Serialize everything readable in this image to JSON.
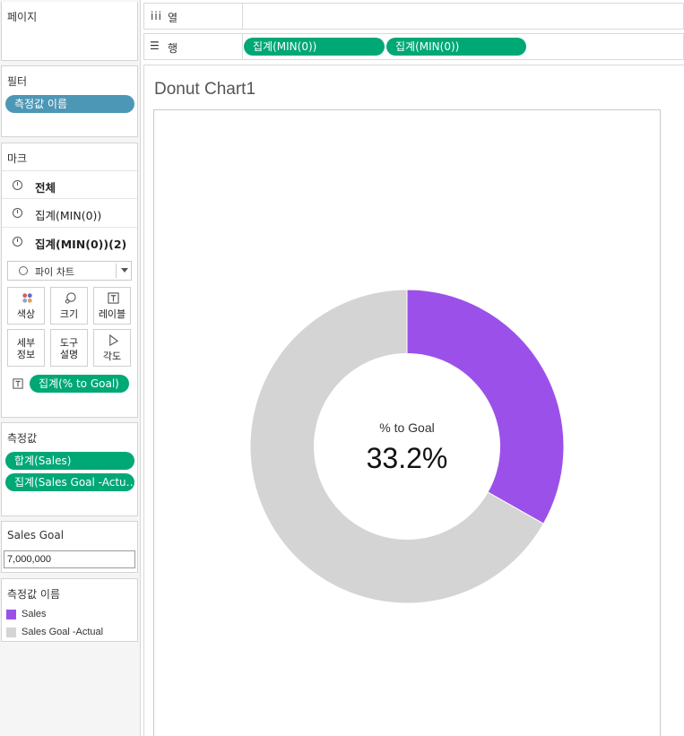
{
  "shelves": {
    "pages_label": "페이지",
    "columns_label": "열",
    "rows_label": "행",
    "row_pills": [
      "집계(MIN(0))",
      "집계(MIN(0))"
    ]
  },
  "filters": {
    "title": "필터",
    "pills": [
      "측정값 이름"
    ]
  },
  "marks": {
    "title": "마크",
    "items": [
      {
        "label": "전체",
        "bold": false
      },
      {
        "label": "집계(MIN(0))",
        "bold": false
      },
      {
        "label": "집계(MIN(0))(2)",
        "bold": true
      }
    ],
    "mark_type": "파이 차트",
    "buttons": [
      "색상",
      "크기",
      "레이블",
      "세부\n정보",
      "도구\n설명",
      "각도"
    ],
    "label_pill": "집계(% to Goal)"
  },
  "measure_values": {
    "title": "측정값",
    "pills": [
      "합계(Sales)",
      "집계(Sales Goal -Actu…"
    ]
  },
  "parameter": {
    "title": "Sales Goal",
    "value": "7,000,000"
  },
  "legend": {
    "title": "측정값 이름",
    "items": [
      {
        "label": "Sales",
        "color": "#9b51e9"
      },
      {
        "label": "Sales Goal -Actual",
        "color": "#d4d4d4"
      }
    ]
  },
  "view": {
    "title": "Donut Chart1",
    "center_label": "% to Goal",
    "center_value": "33.2%"
  },
  "chart_data": {
    "type": "pie",
    "title": "Donut Chart1",
    "categories": [
      "Sales",
      "Sales Goal -Actual"
    ],
    "values": [
      0.332,
      0.668
    ],
    "colors": [
      "#9b51e9",
      "#d4d4d4"
    ],
    "hole_label": "% to Goal",
    "hole_value": "33.2%"
  }
}
